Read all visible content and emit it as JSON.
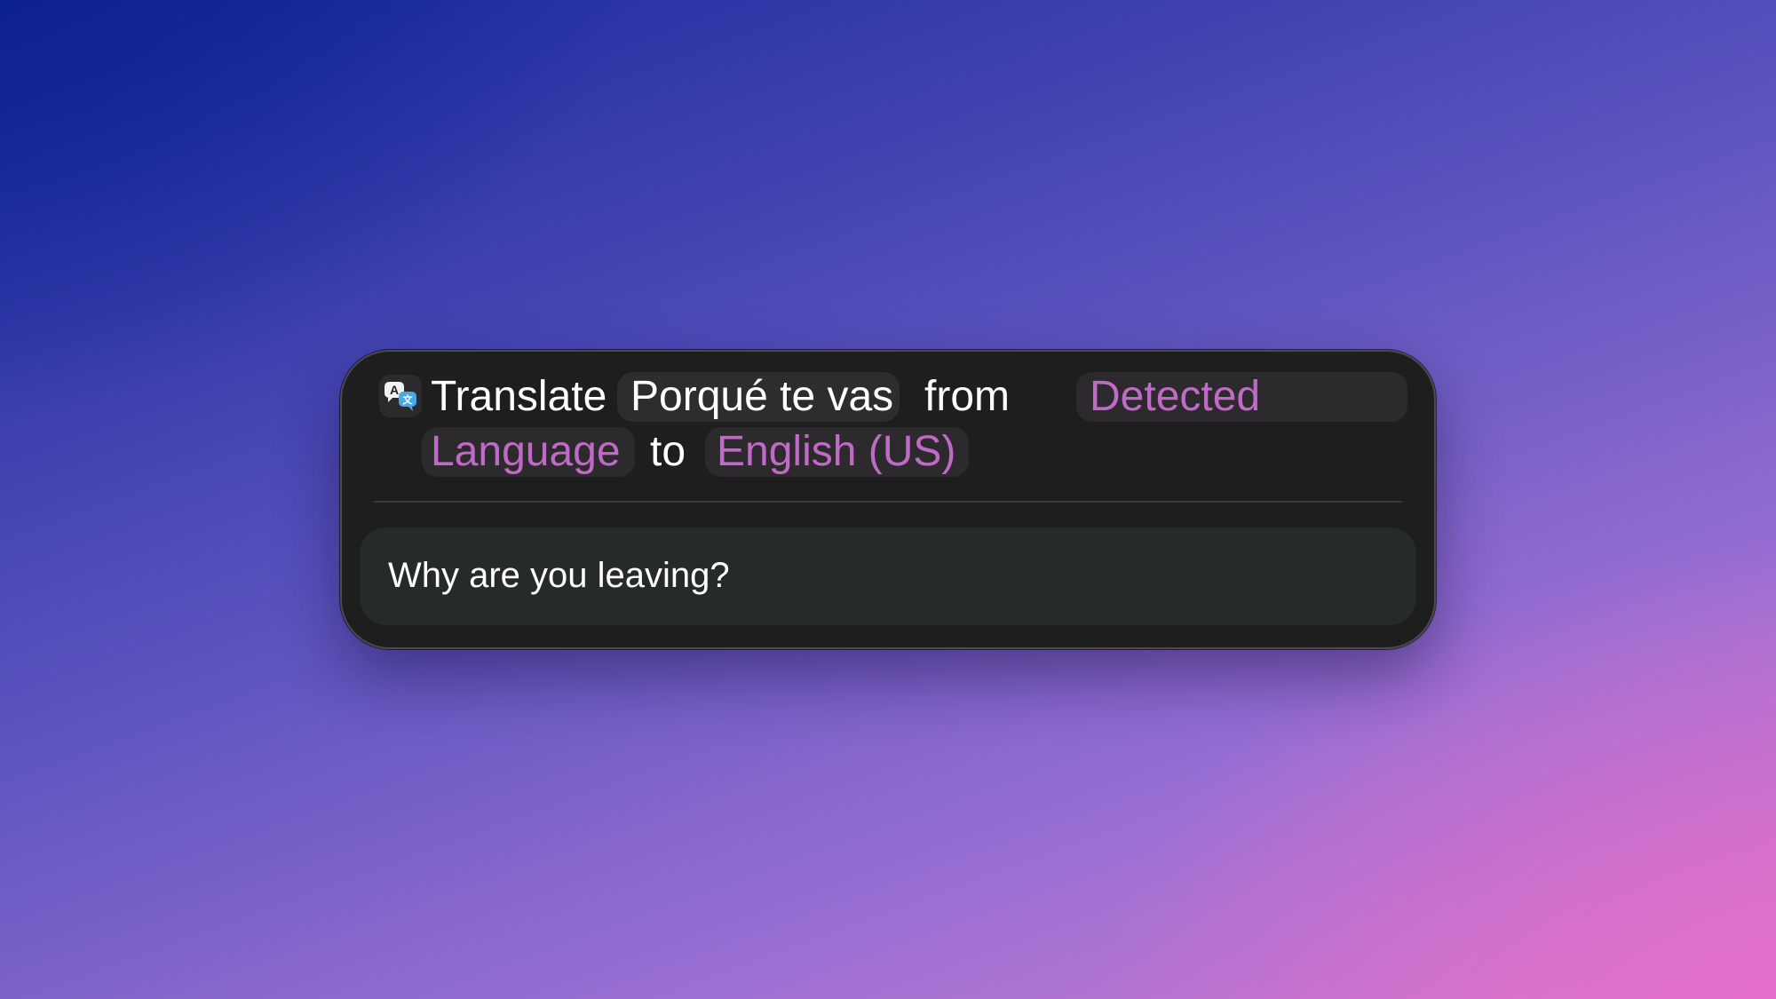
{
  "action": {
    "app_icon": "translate-icon",
    "verb": "Translate",
    "input_text": "Porqué te vas",
    "from_word": "from",
    "source_language_line1": "Detected",
    "source_language_line2": "Language",
    "to_word": "to",
    "target_language": "English (US)"
  },
  "result": {
    "text": "Why are you leaving?"
  },
  "colors": {
    "accent": "#c06ac7",
    "card": "#1e1e1f",
    "result_background": "#252a2a"
  }
}
